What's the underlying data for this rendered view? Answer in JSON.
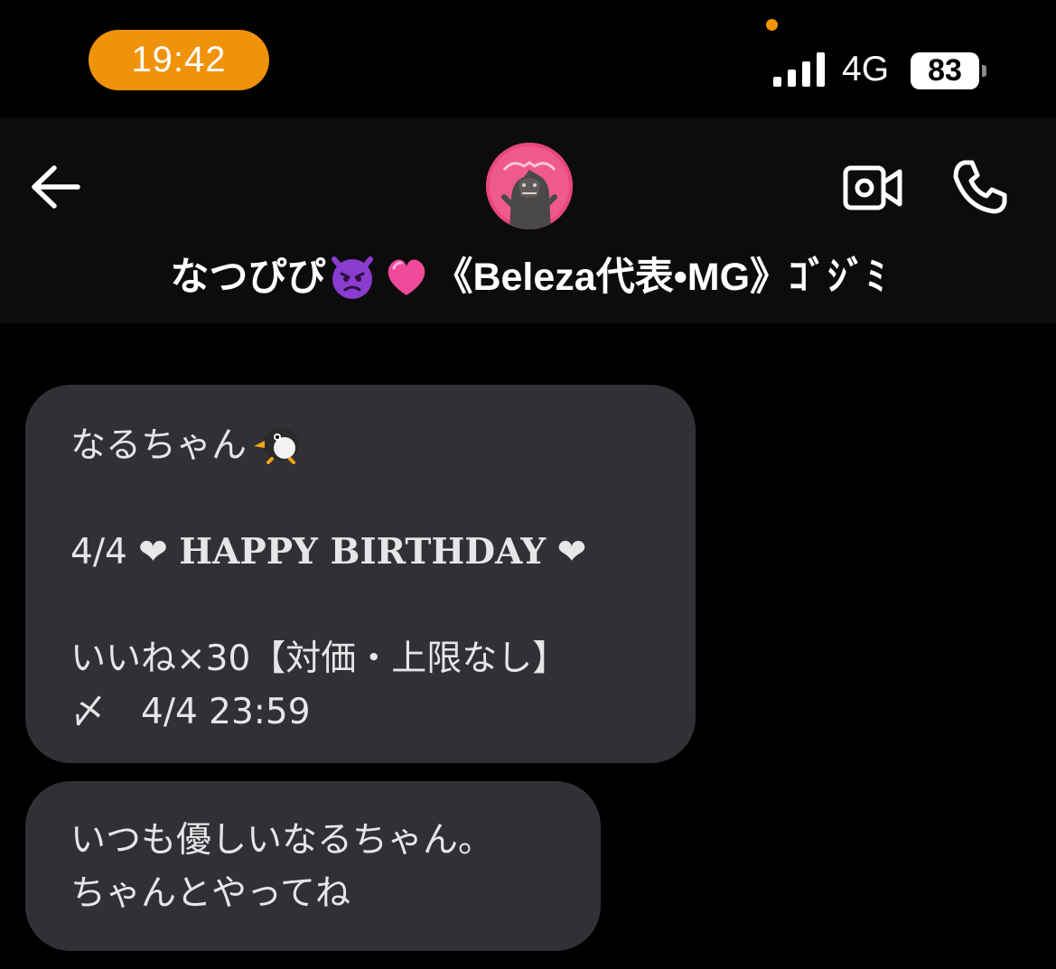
{
  "status_bar": {
    "time": "19:42",
    "network": "4G",
    "battery": "83",
    "accent_color": "#f0920a"
  },
  "header": {
    "back_icon": "arrow-left-icon",
    "video_icon": "video-call-icon",
    "call_icon": "phone-icon",
    "contact_name_part1": "なつぴぴ",
    "contact_name_part2": "《Beleza代表•MG》ｺﾞｼﾞﾐ",
    "name_emojis": [
      "angry-devil-emoji",
      "pink-heart-emoji"
    ]
  },
  "messages": [
    {
      "greeting": "なるちゃん",
      "birthday_date": "4/4",
      "birthday_text": "HAPPY BIRTHDAY",
      "heart": "❤",
      "request": "いいね×30【対価・上限なし】",
      "deadline": "〆　4/4 23:59"
    },
    {
      "line1": "いつも優しいなるちゃん。",
      "line2": "ちゃんとやってね"
    }
  ],
  "colors": {
    "background": "#000000",
    "header": "#0c0c0d",
    "bubble": "#2f3134",
    "text": "#e6e6e8"
  }
}
